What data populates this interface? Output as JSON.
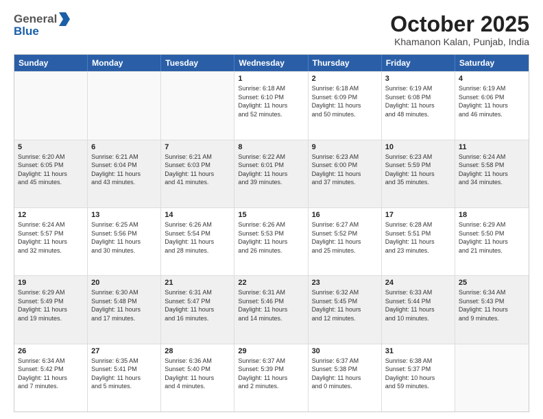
{
  "header": {
    "logo": {
      "general": "General",
      "blue": "Blue"
    },
    "month_title": "October 2025",
    "location": "Khamanon Kalan, Punjab, India"
  },
  "weekdays": [
    "Sunday",
    "Monday",
    "Tuesday",
    "Wednesday",
    "Thursday",
    "Friday",
    "Saturday"
  ],
  "rows": [
    [
      {
        "day": "",
        "lines": [],
        "empty": true
      },
      {
        "day": "",
        "lines": [],
        "empty": true
      },
      {
        "day": "",
        "lines": [],
        "empty": true
      },
      {
        "day": "1",
        "lines": [
          "Sunrise: 6:18 AM",
          "Sunset: 6:10 PM",
          "Daylight: 11 hours",
          "and 52 minutes."
        ],
        "empty": false
      },
      {
        "day": "2",
        "lines": [
          "Sunrise: 6:18 AM",
          "Sunset: 6:09 PM",
          "Daylight: 11 hours",
          "and 50 minutes."
        ],
        "empty": false
      },
      {
        "day": "3",
        "lines": [
          "Sunrise: 6:19 AM",
          "Sunset: 6:08 PM",
          "Daylight: 11 hours",
          "and 48 minutes."
        ],
        "empty": false
      },
      {
        "day": "4",
        "lines": [
          "Sunrise: 6:19 AM",
          "Sunset: 6:06 PM",
          "Daylight: 11 hours",
          "and 46 minutes."
        ],
        "empty": false
      }
    ],
    [
      {
        "day": "5",
        "lines": [
          "Sunrise: 6:20 AM",
          "Sunset: 6:05 PM",
          "Daylight: 11 hours",
          "and 45 minutes."
        ],
        "empty": false
      },
      {
        "day": "6",
        "lines": [
          "Sunrise: 6:21 AM",
          "Sunset: 6:04 PM",
          "Daylight: 11 hours",
          "and 43 minutes."
        ],
        "empty": false
      },
      {
        "day": "7",
        "lines": [
          "Sunrise: 6:21 AM",
          "Sunset: 6:03 PM",
          "Daylight: 11 hours",
          "and 41 minutes."
        ],
        "empty": false
      },
      {
        "day": "8",
        "lines": [
          "Sunrise: 6:22 AM",
          "Sunset: 6:01 PM",
          "Daylight: 11 hours",
          "and 39 minutes."
        ],
        "empty": false
      },
      {
        "day": "9",
        "lines": [
          "Sunrise: 6:23 AM",
          "Sunset: 6:00 PM",
          "Daylight: 11 hours",
          "and 37 minutes."
        ],
        "empty": false
      },
      {
        "day": "10",
        "lines": [
          "Sunrise: 6:23 AM",
          "Sunset: 5:59 PM",
          "Daylight: 11 hours",
          "and 35 minutes."
        ],
        "empty": false
      },
      {
        "day": "11",
        "lines": [
          "Sunrise: 6:24 AM",
          "Sunset: 5:58 PM",
          "Daylight: 11 hours",
          "and 34 minutes."
        ],
        "empty": false
      }
    ],
    [
      {
        "day": "12",
        "lines": [
          "Sunrise: 6:24 AM",
          "Sunset: 5:57 PM",
          "Daylight: 11 hours",
          "and 32 minutes."
        ],
        "empty": false
      },
      {
        "day": "13",
        "lines": [
          "Sunrise: 6:25 AM",
          "Sunset: 5:56 PM",
          "Daylight: 11 hours",
          "and 30 minutes."
        ],
        "empty": false
      },
      {
        "day": "14",
        "lines": [
          "Sunrise: 6:26 AM",
          "Sunset: 5:54 PM",
          "Daylight: 11 hours",
          "and 28 minutes."
        ],
        "empty": false
      },
      {
        "day": "15",
        "lines": [
          "Sunrise: 6:26 AM",
          "Sunset: 5:53 PM",
          "Daylight: 11 hours",
          "and 26 minutes."
        ],
        "empty": false
      },
      {
        "day": "16",
        "lines": [
          "Sunrise: 6:27 AM",
          "Sunset: 5:52 PM",
          "Daylight: 11 hours",
          "and 25 minutes."
        ],
        "empty": false
      },
      {
        "day": "17",
        "lines": [
          "Sunrise: 6:28 AM",
          "Sunset: 5:51 PM",
          "Daylight: 11 hours",
          "and 23 minutes."
        ],
        "empty": false
      },
      {
        "day": "18",
        "lines": [
          "Sunrise: 6:29 AM",
          "Sunset: 5:50 PM",
          "Daylight: 11 hours",
          "and 21 minutes."
        ],
        "empty": false
      }
    ],
    [
      {
        "day": "19",
        "lines": [
          "Sunrise: 6:29 AM",
          "Sunset: 5:49 PM",
          "Daylight: 11 hours",
          "and 19 minutes."
        ],
        "empty": false
      },
      {
        "day": "20",
        "lines": [
          "Sunrise: 6:30 AM",
          "Sunset: 5:48 PM",
          "Daylight: 11 hours",
          "and 17 minutes."
        ],
        "empty": false
      },
      {
        "day": "21",
        "lines": [
          "Sunrise: 6:31 AM",
          "Sunset: 5:47 PM",
          "Daylight: 11 hours",
          "and 16 minutes."
        ],
        "empty": false
      },
      {
        "day": "22",
        "lines": [
          "Sunrise: 6:31 AM",
          "Sunset: 5:46 PM",
          "Daylight: 11 hours",
          "and 14 minutes."
        ],
        "empty": false
      },
      {
        "day": "23",
        "lines": [
          "Sunrise: 6:32 AM",
          "Sunset: 5:45 PM",
          "Daylight: 11 hours",
          "and 12 minutes."
        ],
        "empty": false
      },
      {
        "day": "24",
        "lines": [
          "Sunrise: 6:33 AM",
          "Sunset: 5:44 PM",
          "Daylight: 11 hours",
          "and 10 minutes."
        ],
        "empty": false
      },
      {
        "day": "25",
        "lines": [
          "Sunrise: 6:34 AM",
          "Sunset: 5:43 PM",
          "Daylight: 11 hours",
          "and 9 minutes."
        ],
        "empty": false
      }
    ],
    [
      {
        "day": "26",
        "lines": [
          "Sunrise: 6:34 AM",
          "Sunset: 5:42 PM",
          "Daylight: 11 hours",
          "and 7 minutes."
        ],
        "empty": false
      },
      {
        "day": "27",
        "lines": [
          "Sunrise: 6:35 AM",
          "Sunset: 5:41 PM",
          "Daylight: 11 hours",
          "and 5 minutes."
        ],
        "empty": false
      },
      {
        "day": "28",
        "lines": [
          "Sunrise: 6:36 AM",
          "Sunset: 5:40 PM",
          "Daylight: 11 hours",
          "and 4 minutes."
        ],
        "empty": false
      },
      {
        "day": "29",
        "lines": [
          "Sunrise: 6:37 AM",
          "Sunset: 5:39 PM",
          "Daylight: 11 hours",
          "and 2 minutes."
        ],
        "empty": false
      },
      {
        "day": "30",
        "lines": [
          "Sunrise: 6:37 AM",
          "Sunset: 5:38 PM",
          "Daylight: 11 hours",
          "and 0 minutes."
        ],
        "empty": false
      },
      {
        "day": "31",
        "lines": [
          "Sunrise: 6:38 AM",
          "Sunset: 5:37 PM",
          "Daylight: 10 hours",
          "and 59 minutes."
        ],
        "empty": false
      },
      {
        "day": "",
        "lines": [],
        "empty": true
      }
    ]
  ]
}
